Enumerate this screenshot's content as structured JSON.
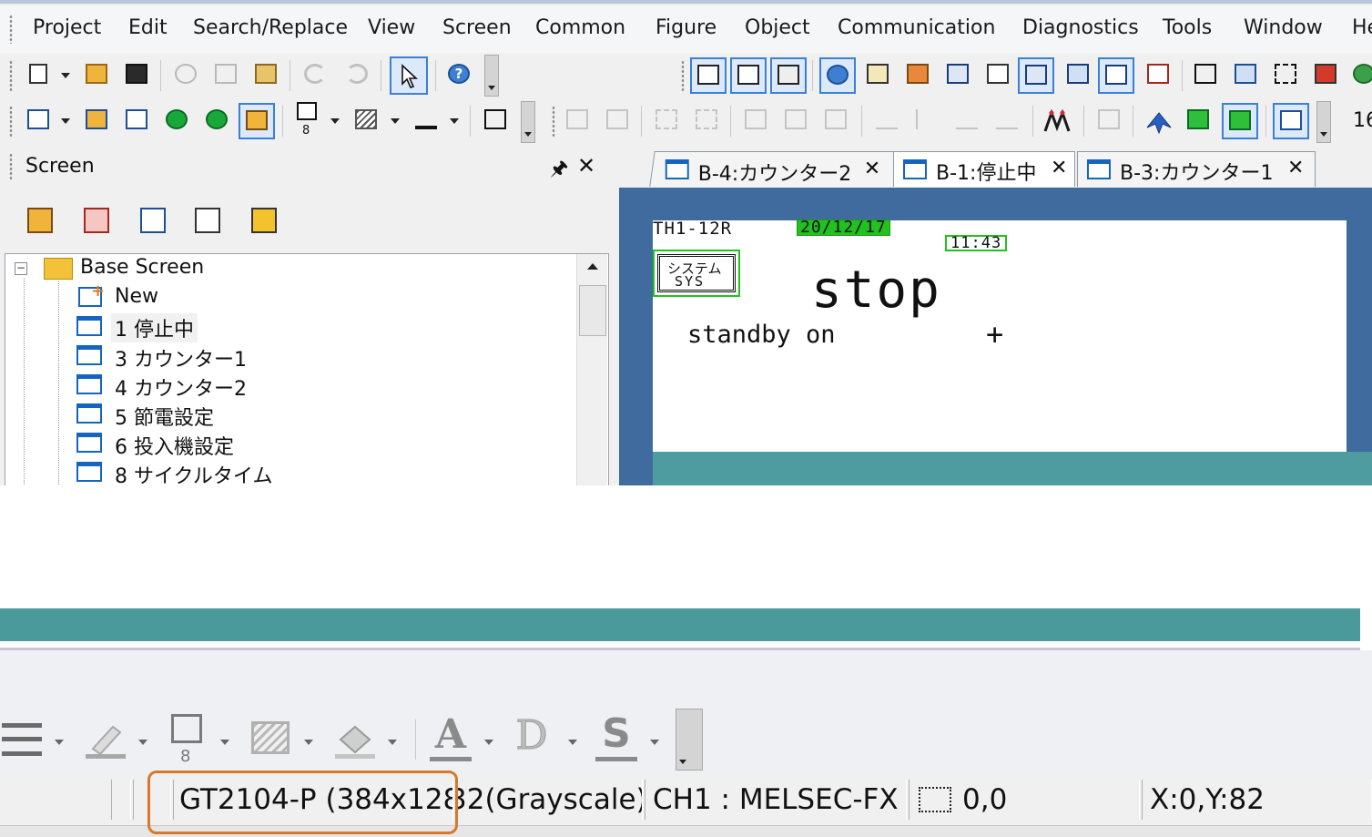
{
  "menu": {
    "items": [
      "Project",
      "Edit",
      "Search/Replace",
      "View",
      "Screen",
      "Common",
      "Figure",
      "Object",
      "Communication",
      "Diagnostics",
      "Tools",
      "Window",
      "He"
    ]
  },
  "toolbar": {
    "line_width_value": "8",
    "font_size_fragment": "16"
  },
  "screen_panel": {
    "title": "Screen",
    "pin_icon": "pin-icon",
    "close_icon": "close-icon",
    "tree": {
      "root": "Base Screen",
      "items": [
        {
          "label": "New",
          "icon": "new-screen-icon"
        },
        {
          "label": "1 停止中",
          "icon": "screen-icon",
          "selected": true
        },
        {
          "label": "3 カウンター1",
          "icon": "screen-icon"
        },
        {
          "label": "4 カウンター2",
          "icon": "screen-icon"
        },
        {
          "label": "5 節電設定",
          "icon": "screen-icon"
        },
        {
          "label": "6 投入機設定",
          "icon": "screen-icon"
        },
        {
          "label": "8 サイクルタイム",
          "icon": "screen-icon"
        }
      ]
    }
  },
  "editor": {
    "tabs": [
      {
        "label": "B-4:カウンター2",
        "active": false
      },
      {
        "label": "B-1:停止中",
        "active": true
      },
      {
        "label": "B-3:カウンター1",
        "active": false
      }
    ],
    "close_glyph": "✕",
    "canvas": {
      "model_label": "TH1-12R",
      "date": "20/12/17",
      "time": "11:43",
      "system_button_line1": "システム",
      "system_button_line2": "SYS",
      "big_text": "stop",
      "status_text": "standby on",
      "cursor_glyph": "+"
    }
  },
  "lower_toolbar": {
    "line_width_value": "8"
  },
  "statusbar": {
    "got_type": "GT2104-P (384x128)",
    "color_mode": "32(Grayscale)",
    "channel": "CH1 : MELSEC-FX",
    "position": "0,0",
    "cursor": "X:0,Y:82"
  },
  "colors": {
    "highlight_box": "#d9782a",
    "editor_bg": "#3f6b9e",
    "teal": "#4e9c9f",
    "object_outline": "#22c21e"
  }
}
